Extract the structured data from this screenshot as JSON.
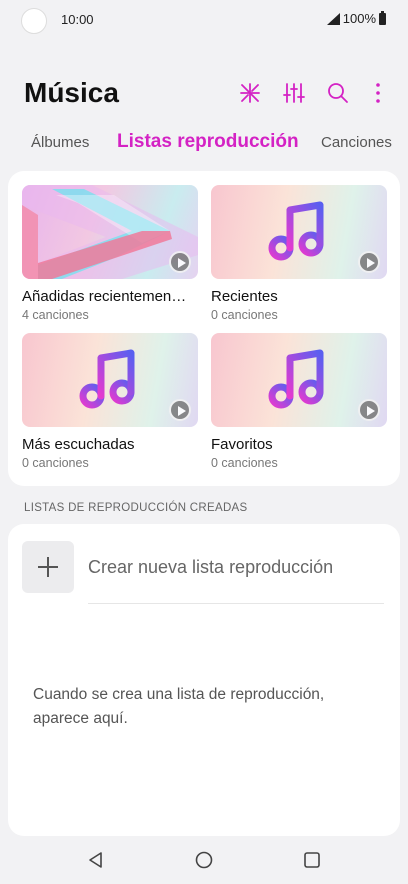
{
  "status_bar": {
    "time": "10:00",
    "battery": "100%"
  },
  "header": {
    "title": "Música",
    "icons": [
      "music-visualizer-icon",
      "equalizer-icon",
      "search-icon",
      "more-vert-icon"
    ],
    "accent_color": "#d422c4"
  },
  "tabs": [
    {
      "label": "Álbumes",
      "active": false
    },
    {
      "label": "Listas reproducción",
      "active": true
    },
    {
      "label": "Canciones",
      "active": false
    }
  ],
  "default_playlists": [
    {
      "name": "Añadidas recientemen…",
      "count": "4 canciones"
    },
    {
      "name": "Recientes",
      "count": "0 canciones"
    },
    {
      "name": "Más escuchadas",
      "count": "0 canciones"
    },
    {
      "name": "Favoritos",
      "count": "0 canciones"
    }
  ],
  "created_section": {
    "label": "LISTAS DE REPRODUCCIÓN CREADAS",
    "new_playlist_label": "Crear nueva lista reproducción",
    "empty_message": "Cuando se crea una lista de reproducción, aparece aquí."
  },
  "nav_bar": {
    "icons": [
      "back-icon",
      "home-icon",
      "recents-icon"
    ]
  }
}
